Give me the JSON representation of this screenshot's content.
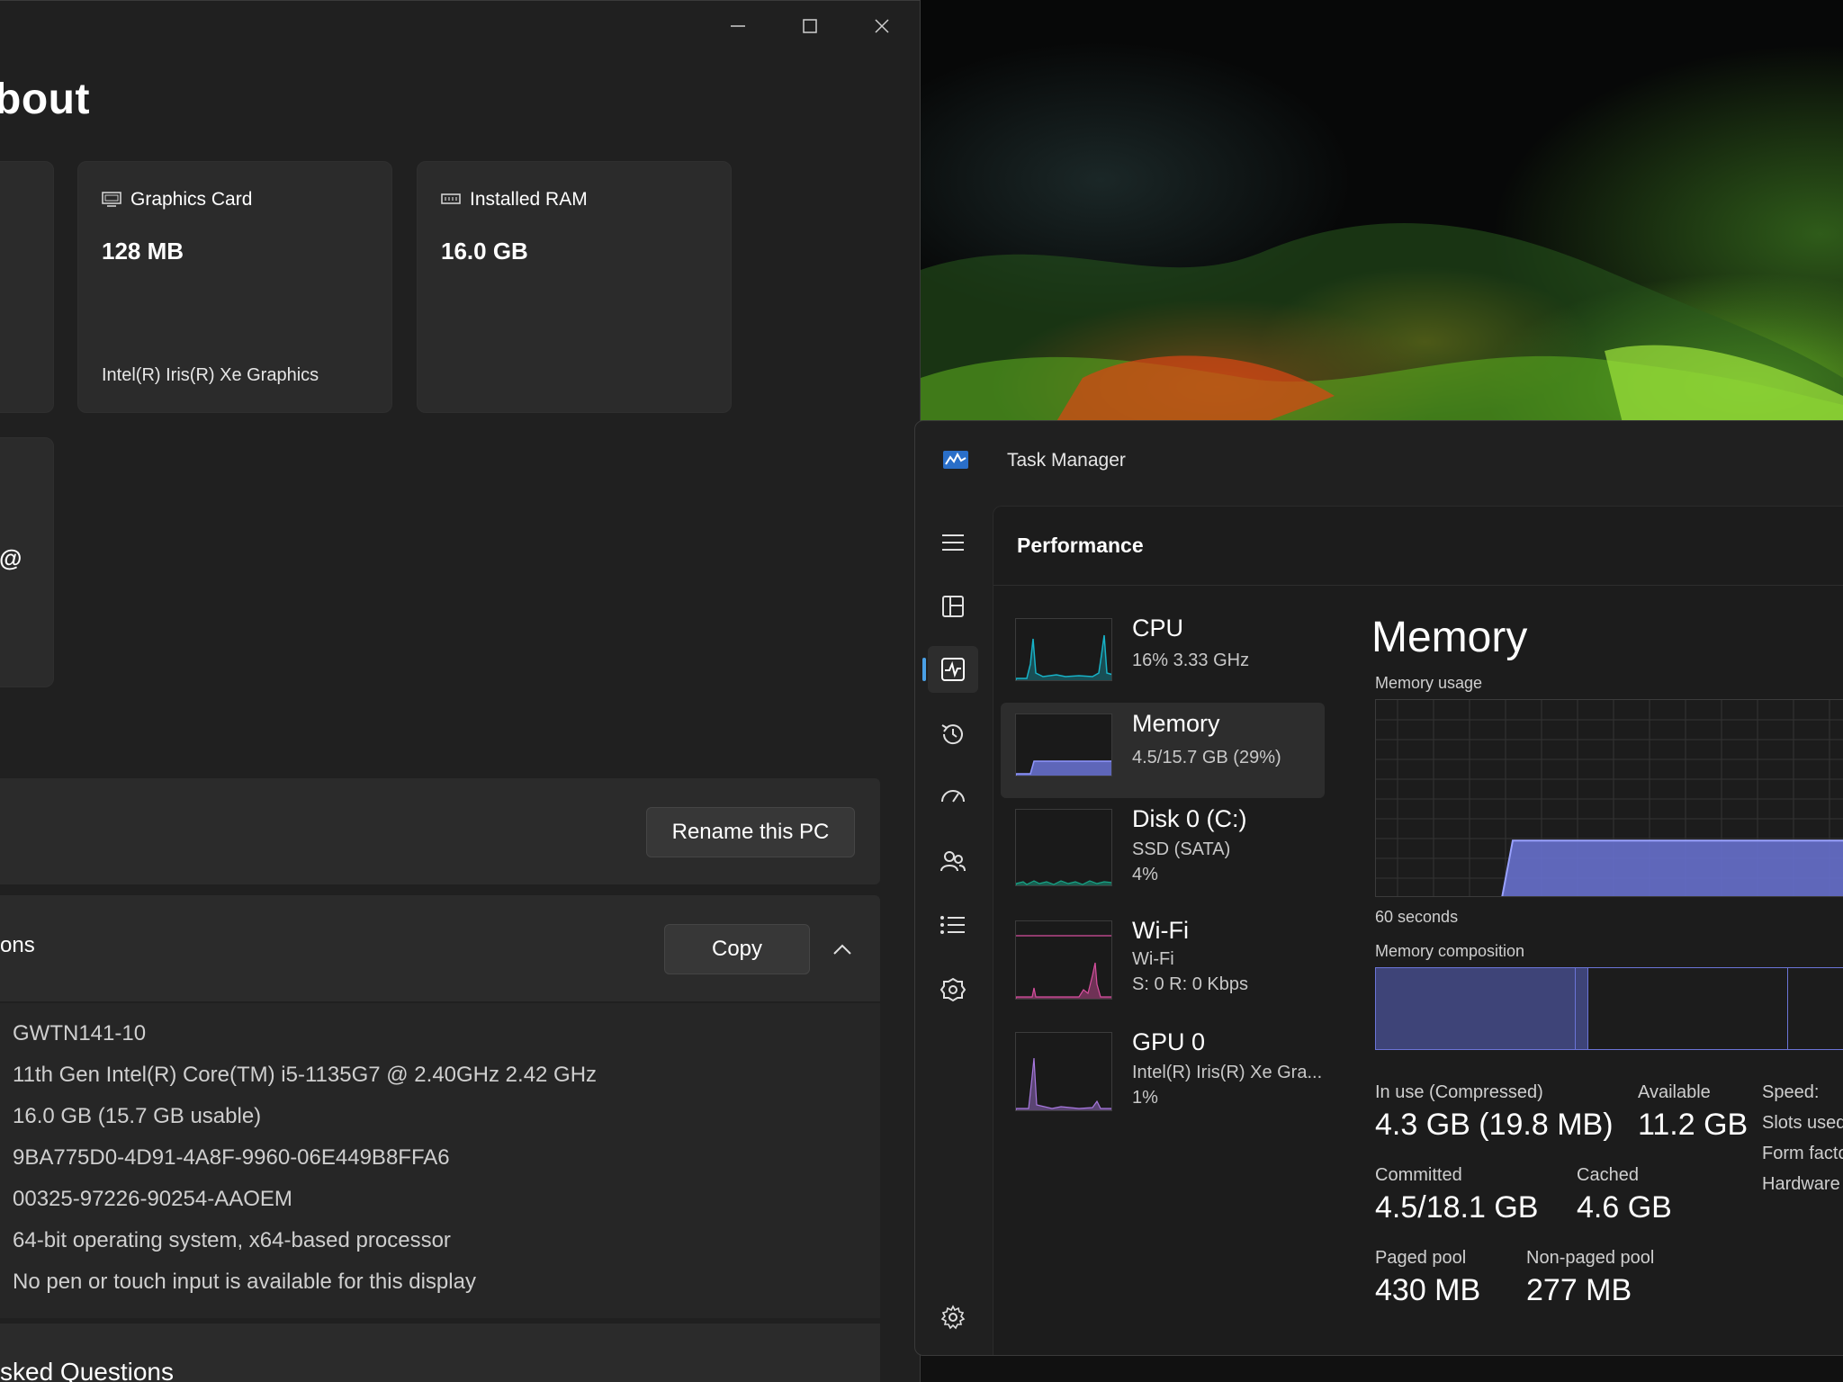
{
  "settings": {
    "heading": "bout",
    "cards": [
      {
        "title": "Graphics Card",
        "value": "128 MB",
        "sub": "Intel(R) Iris(R) Xe Graphics",
        "icon": "monitor-icon"
      },
      {
        "title": "Installed RAM",
        "value": "16.0 GB",
        "sub": "",
        "icon": "memory-chip-icon"
      }
    ],
    "partial_card_text": "@",
    "rename_button": "Rename this PC",
    "specs_section_label": "ons",
    "copy_button": "Copy",
    "spec_values": [
      "GWTN141-10",
      "11th Gen Intel(R) Core(TM) i5-1135G7 @ 2.40GHz   2.42 GHz",
      "16.0 GB (15.7 GB usable)",
      "9BA775D0-4D91-4A8F-9960-06E449B8FFA6",
      "00325-97226-90254-AAOEM",
      "64-bit operating system, x64-based processor",
      "No pen or touch input is available for this display"
    ],
    "faq_label": "sked Questions"
  },
  "taskmanager": {
    "title": "Task Manager",
    "page_title": "Performance",
    "resources": [
      {
        "name": "CPU",
        "sub1": "16%  3.33 GHz",
        "sub2": "",
        "color": "#17b2c7"
      },
      {
        "name": "Memory",
        "sub1": "4.5/15.7 GB (29%)",
        "sub2": "",
        "color": "#6b74d6"
      },
      {
        "name": "Disk 0 (C:)",
        "sub1": "SSD (SATA)",
        "sub2": "4%",
        "color": "#18a588"
      },
      {
        "name": "Wi-Fi",
        "sub1": "Wi-Fi",
        "sub2": "S: 0 R: 0 Kbps",
        "color": "#d84f9f"
      },
      {
        "name": "GPU 0",
        "sub1": "Intel(R) Iris(R) Xe Gra...",
        "sub2": "1%",
        "color": "#a878e0"
      }
    ],
    "detail": {
      "title": "Memory",
      "usage_label": "Memory usage",
      "time_label": "60 seconds",
      "composition_label": "Memory composition",
      "usage_percent": 29,
      "stats": {
        "in_use_label": "In use (Compressed)",
        "in_use_value": "4.3 GB (19.8 MB)",
        "available_label": "Available",
        "available_value": "11.2 GB",
        "committed_label": "Committed",
        "committed_value": "4.5/18.1 GB",
        "cached_label": "Cached",
        "cached_value": "4.6 GB",
        "paged_label": "Paged pool",
        "paged_value": "430 MB",
        "nonpaged_label": "Non-paged pool",
        "nonpaged_value": "277 MB",
        "speed_label": "Speed:",
        "slots_label": "Slots used",
        "form_label": "Form facto",
        "hardware_label": "Hardware"
      }
    }
  }
}
